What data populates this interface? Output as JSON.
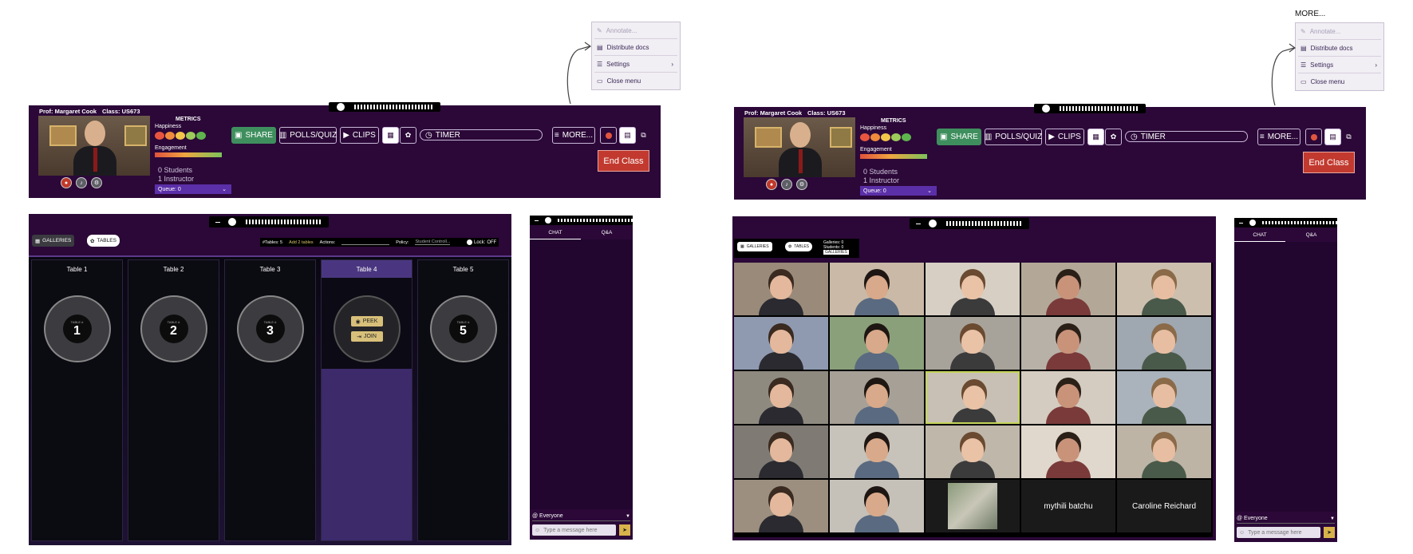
{
  "menu": {
    "more_heading": "MORE...",
    "items": [
      {
        "label": "Annotate...",
        "icon": "pencil-icon",
        "dim": true
      },
      {
        "label": "Distribute docs",
        "icon": "document-icon"
      },
      {
        "label": "Settings",
        "icon": "sliders-icon",
        "chevron": "›"
      },
      {
        "label": "Close menu",
        "icon": "monitor-icon"
      }
    ]
  },
  "topbar": {
    "prof_label": "Prof: Margaret Cook",
    "class_label": "Class: US673",
    "metrics_title": "METRICS",
    "happiness_label": "Happiness",
    "engagement_label": "Engagement",
    "students_count": "0 Students",
    "instructor_count": "1 Instructor",
    "queue_label": "Queue: 0",
    "share_label": "SHARE",
    "polls_label": "POLLS/QUIZ",
    "clips_label": "CLIPS",
    "timer_label": "TIMER",
    "more_label": "MORE...",
    "end_class_label": "End Class",
    "face_colors": [
      "#e8553f",
      "#f08a3c",
      "#f2c64a",
      "#9ccc5a",
      "#5fb54d"
    ]
  },
  "tables_view": {
    "galleries_label": "GALLERIES",
    "tables_label": "TABLES",
    "tables_count": "#Tables: 5",
    "add_tables": "Add 2 tables",
    "actions_label": "Actions:",
    "policy_label": "Policy:",
    "policy_value": "Student Controll...",
    "lock_label": "Lock:",
    "lock_value": "OFF",
    "tables": [
      {
        "name": "Table 1",
        "num": "1"
      },
      {
        "name": "Table 2",
        "num": "2"
      },
      {
        "name": "Table 3",
        "num": "3"
      },
      {
        "name": "Table 4",
        "num": "4"
      },
      {
        "name": "Table 5",
        "num": "5"
      }
    ],
    "table_word": "TABLE #",
    "peek_label": "PEEK",
    "join_label": "JOIN"
  },
  "chat": {
    "tab_chat": "CHAT",
    "tab_qa": "Q&A",
    "recipient": "@ Everyone",
    "placeholder": "Type a message here"
  },
  "gallery_view": {
    "galleries_label": "GALLERIES",
    "tables_label": "TABLES",
    "galleries_count": "Galleries: 0",
    "students_count": "Students: 0",
    "tag": "GALLERIES",
    "name_tiles": [
      "mythili batchu",
      "Caroline Reichard"
    ]
  }
}
